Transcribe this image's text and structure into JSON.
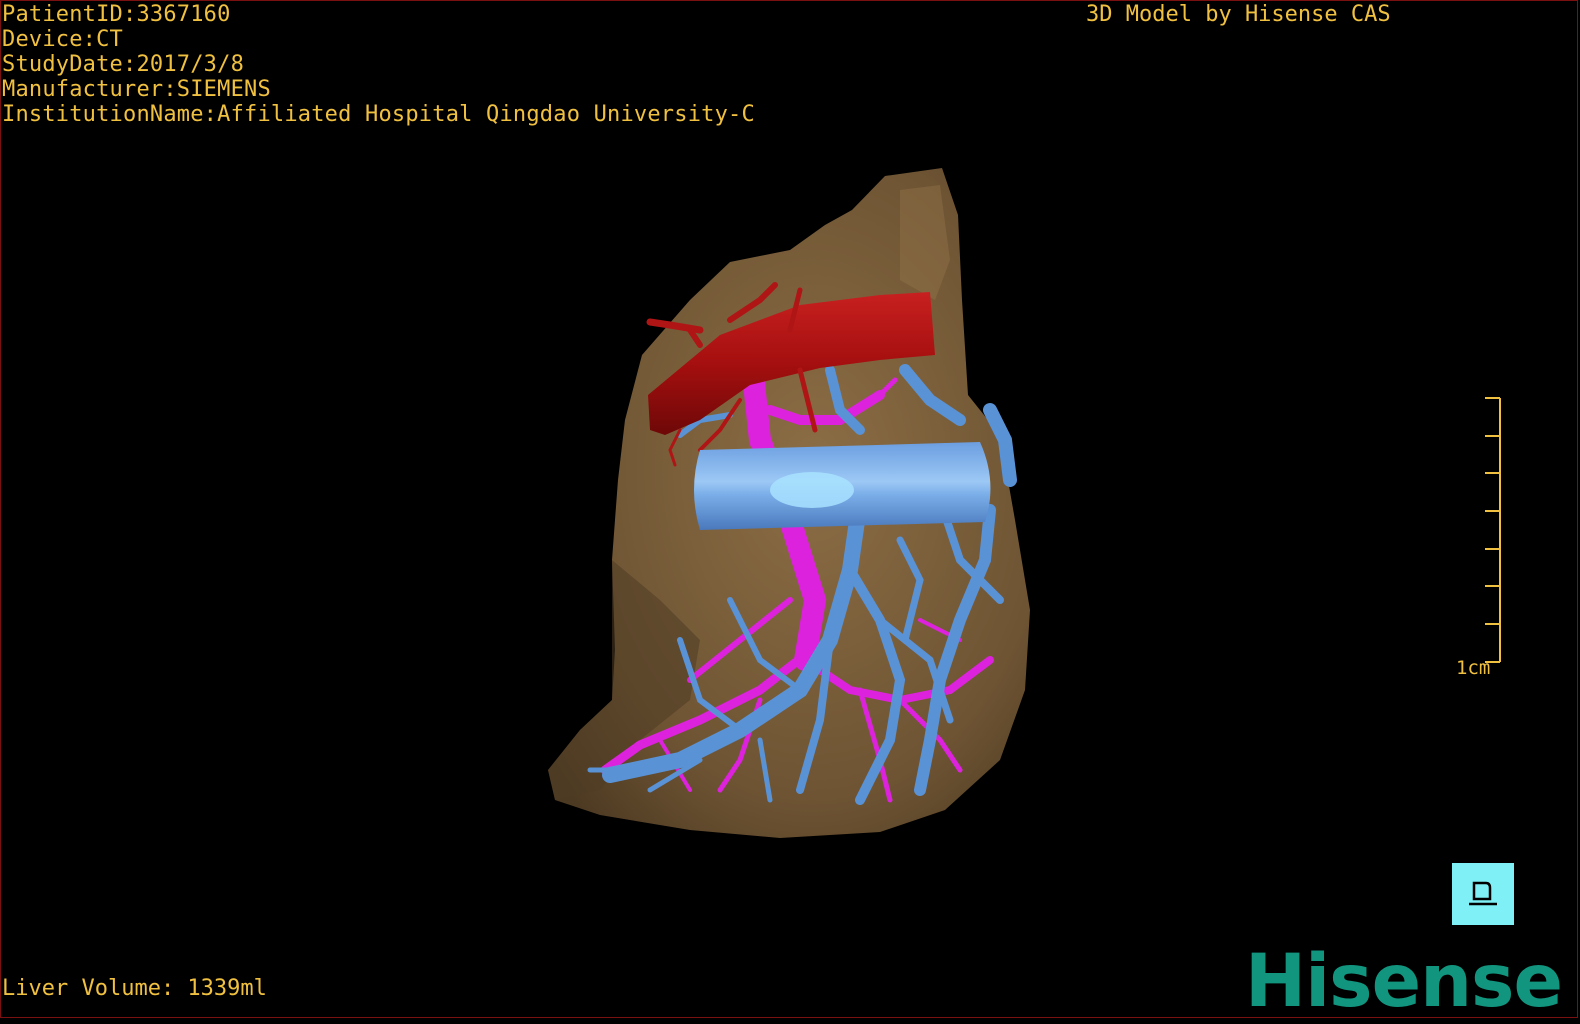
{
  "header": {
    "patient_id": "PatientID:3367160",
    "device": "Device:CT",
    "study_date": "StudyDate:2017/3/8",
    "manufacturer": "Manufacturer:SIEMENS",
    "institution": "InstitutionName:Affiliated Hospital Qingdao University-C",
    "model_credit": "3D Model by Hisense CAS"
  },
  "footer": {
    "liver_volume": "Liver Volume: 1339ml",
    "logo": "Hisense"
  },
  "scale_bar": {
    "label": "1cm"
  },
  "colors": {
    "overlay_text": "#f0c040",
    "liver": "#7a5f3a",
    "hepatic_artery": "#a81010",
    "portal_vein": "#e020e0",
    "hepatic_vein": "#5e96d8",
    "vena_cava": "#7eaeea",
    "orientation_button": "#7ff0f5",
    "logo": "#11957f"
  },
  "icons": {
    "orientation": "orientation-cube-icon"
  }
}
